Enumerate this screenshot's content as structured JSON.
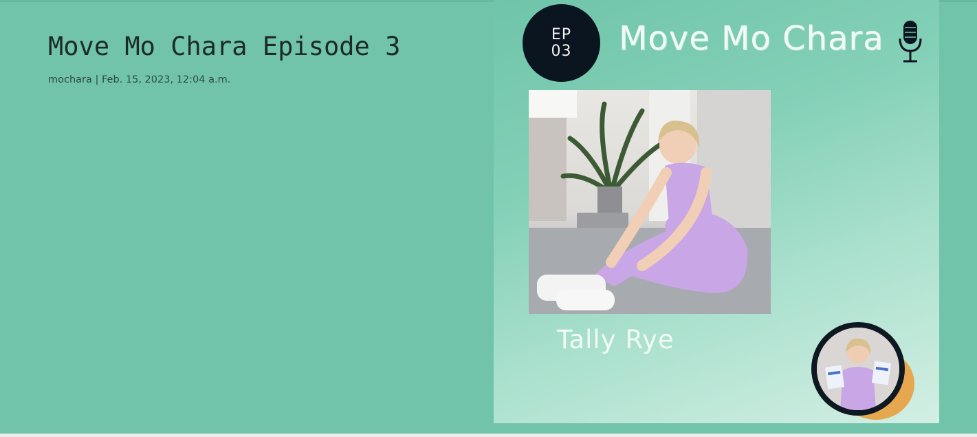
{
  "post": {
    "title": "Move Mo Chara Episode 3",
    "meta": "mochara | Feb. 15, 2023, 12:04 a.m."
  },
  "cover": {
    "episode_line1": "EP",
    "episode_line2": "03",
    "brand": "Move Mo Chara",
    "guest_name": "Tally Rye",
    "icons": [
      "microphone-icon"
    ],
    "colors": {
      "page_background": "#71c4aa",
      "badge": "#0a1520",
      "accent_circle": "#e6a74f",
      "outfit": "#c9a6e6"
    }
  }
}
